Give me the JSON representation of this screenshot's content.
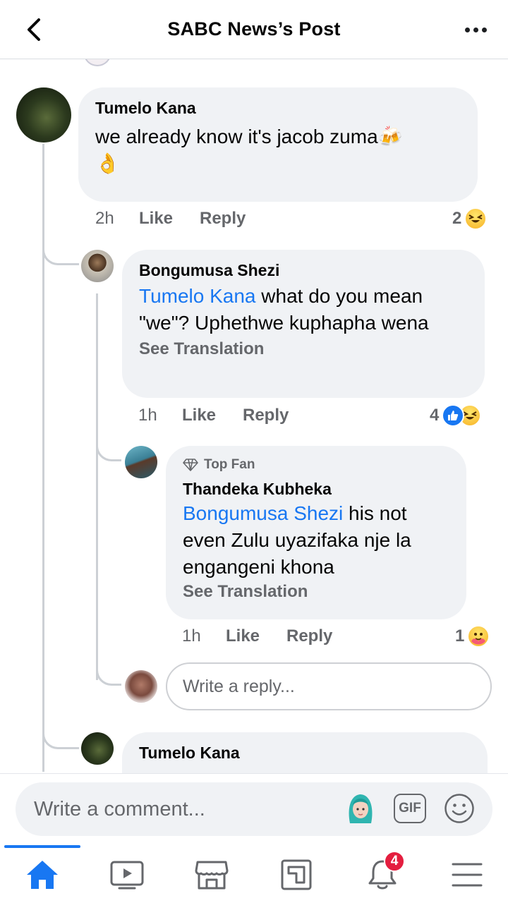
{
  "header": {
    "title": "SABC News’s Post"
  },
  "comments": [
    {
      "author": "Tumelo Kana",
      "text": "we already know it's jacob zuma🍻",
      "text_line2": "👌",
      "time": "2h",
      "like_label": "Like",
      "reply_label": "Reply",
      "reaction_count": "2",
      "reactions": [
        "haha"
      ]
    },
    {
      "author": "Bongumusa Shezi",
      "mention": "Tumelo Kana",
      "text": " what do you mean \"we\"? Uphethwe kuphapha wena",
      "see_translation": "See Translation",
      "time": "1h",
      "like_label": "Like",
      "reply_label": "Reply",
      "reaction_count": "4",
      "reactions": [
        "like",
        "haha"
      ]
    },
    {
      "badge": "Top Fan",
      "author": "Thandeka Kubheka",
      "mention": "Bongumusa Shezi",
      "text": " his not even Zulu uyazifaka nje la engangeni khona",
      "see_translation": "See Translation",
      "time": "1h",
      "like_label": "Like",
      "reply_label": "Reply",
      "reaction_count": "1",
      "reactions": [
        "care"
      ]
    },
    {
      "author": "Tumelo Kana"
    }
  ],
  "reply_input": {
    "placeholder": "Write a reply..."
  },
  "comment_bar": {
    "placeholder": "Write a comment...",
    "gif_label": "GIF"
  },
  "tabbar": {
    "items": [
      "home",
      "watch",
      "marketplace",
      "news",
      "notifications",
      "menu"
    ],
    "notifications_badge": "4",
    "active": "home"
  },
  "colors": {
    "accent": "#1877f2",
    "bubble": "#f0f2f5",
    "muted": "#65676b",
    "badge": "#e41e3f"
  }
}
